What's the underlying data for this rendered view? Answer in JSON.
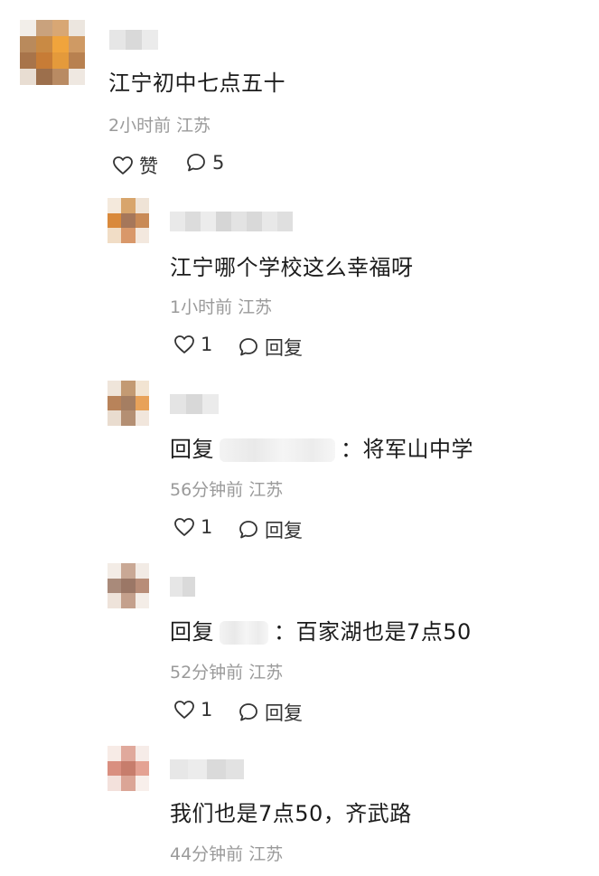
{
  "main_comment": {
    "text": "江宁初中七点五十",
    "meta": "2小时前 江苏",
    "like_label": "赞",
    "reply_count": "5"
  },
  "replies": [
    {
      "text": "江宁哪个学校这么幸福呀",
      "meta": "1小时前 江苏",
      "likes": "1",
      "reply_label": "回复"
    },
    {
      "prefix": "回复",
      "suffix": "：将军山中学",
      "meta": "56分钟前 江苏",
      "likes": "1",
      "reply_label": "回复"
    },
    {
      "prefix": "回复",
      "suffix": "：百家湖也是7点50",
      "meta": "52分钟前 江苏",
      "likes": "1",
      "reply_label": "回复"
    },
    {
      "text": "我们也是7点50，齐武路",
      "meta": "44分钟前 江苏"
    }
  ],
  "colors": {
    "text": "#1c1c1c",
    "meta": "#9a9a9a",
    "icon": "#333333"
  },
  "icons": {
    "like": "heart-outline-icon",
    "comment": "comment-bubble-icon"
  }
}
